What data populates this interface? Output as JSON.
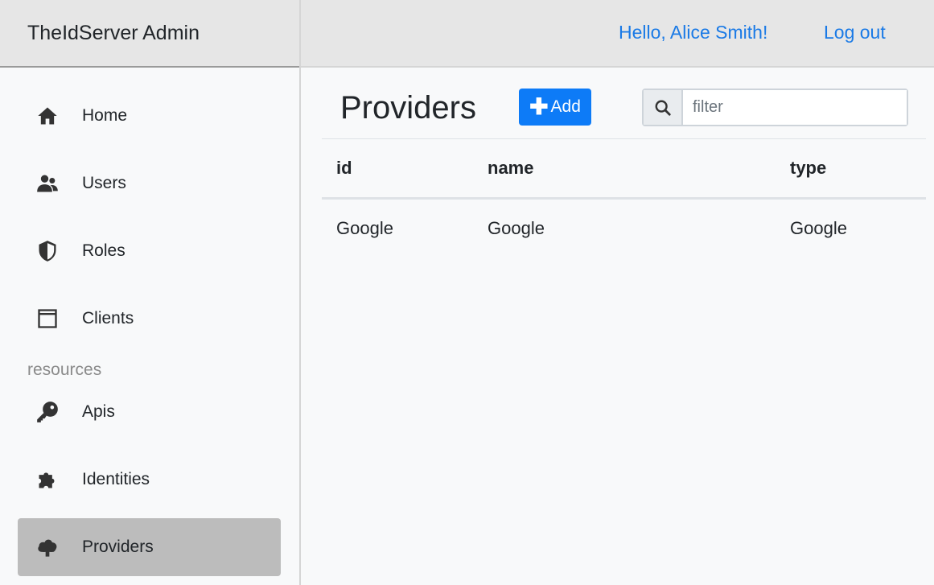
{
  "app": {
    "title": "TheIdServer Admin"
  },
  "topbar": {
    "greeting": "Hello, Alice Smith!",
    "logout": "Log out"
  },
  "sidebar": {
    "items": [
      {
        "label": "Home",
        "icon": "home-icon"
      },
      {
        "label": "Users",
        "icon": "users-icon"
      },
      {
        "label": "Roles",
        "icon": "shield-icon"
      },
      {
        "label": "Clients",
        "icon": "window-icon"
      }
    ],
    "section_label": "resources",
    "resource_items": [
      {
        "label": "Apis",
        "icon": "key-icon"
      },
      {
        "label": "Identities",
        "icon": "puzzle-icon"
      },
      {
        "label": "Providers",
        "icon": "cloud-upload-icon",
        "active": true
      }
    ]
  },
  "main": {
    "title": "Providers",
    "add_label": "Add",
    "filter_placeholder": "filter",
    "table": {
      "columns": [
        "id",
        "name",
        "type"
      ],
      "rows": [
        [
          "Google",
          "Google",
          "Google"
        ]
      ]
    }
  },
  "colors": {
    "accent": "#0d7bf7",
    "link": "#1a7ae6",
    "active_item": "#bcbcbc"
  }
}
